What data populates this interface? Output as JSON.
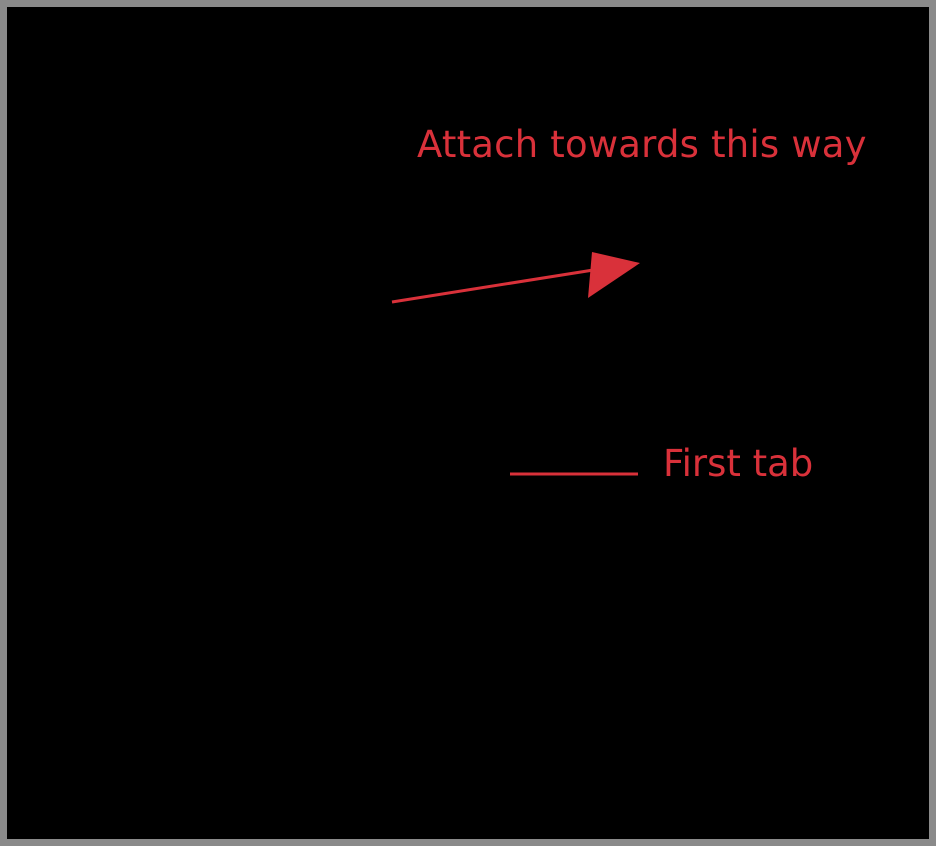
{
  "annotations": {
    "direction_label": "Attach towards this way",
    "tab_label": "First tab"
  },
  "colors": {
    "background": "#000000",
    "border": "#8a8a8a",
    "line_art": "#000000",
    "accent": "#d9313a"
  },
  "icons": {
    "direction_arrow": "arrow-right-icon",
    "pointer_line": "leader-line"
  }
}
